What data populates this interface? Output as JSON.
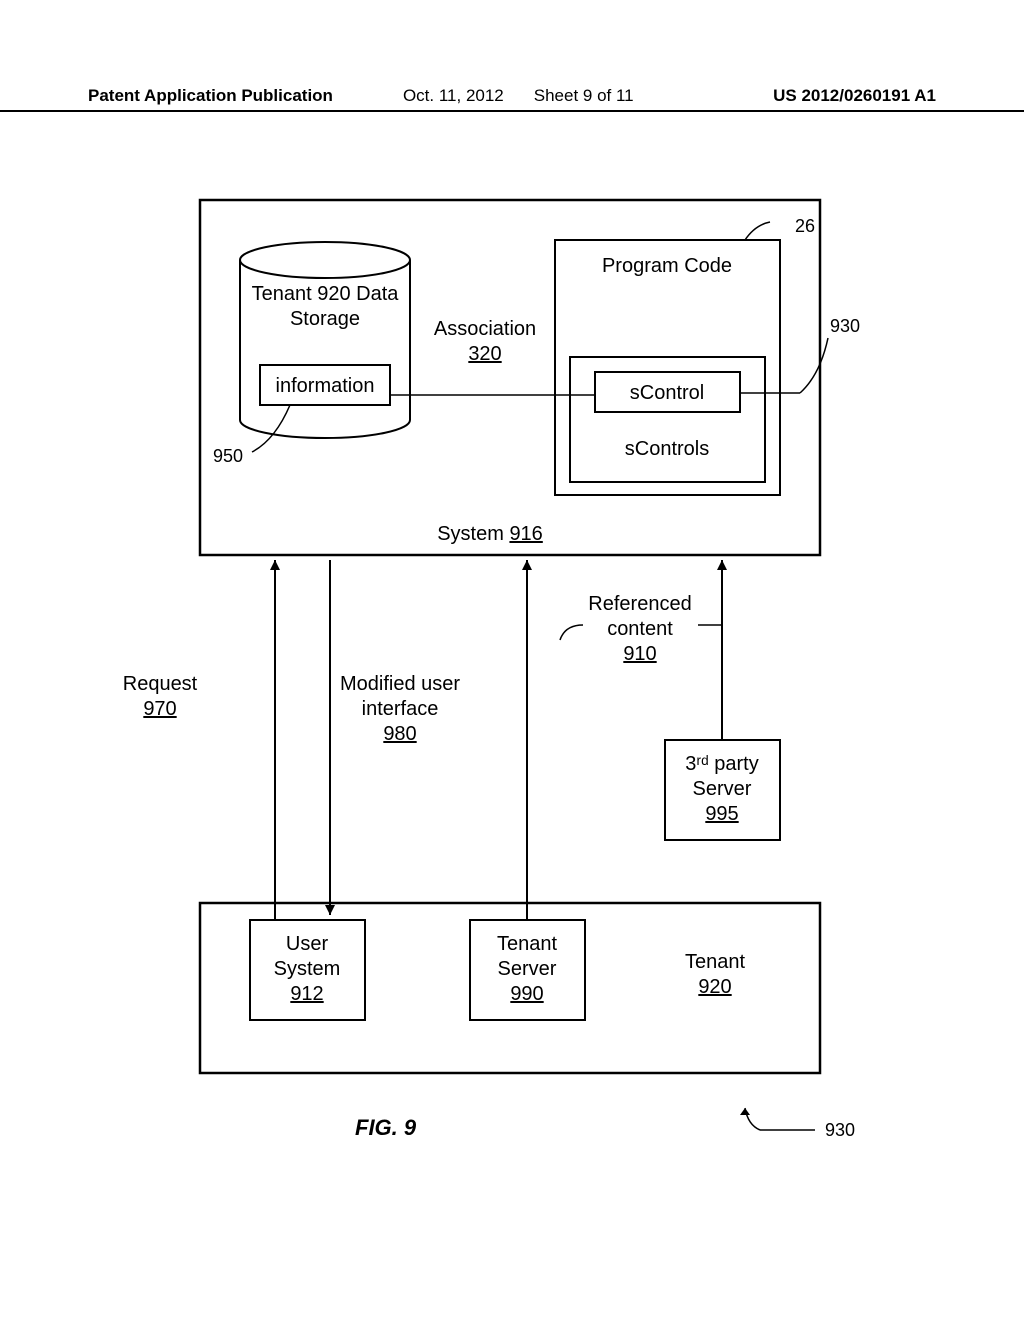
{
  "header": {
    "left": "Patent Application Publication",
    "date": "Oct. 11, 2012",
    "sheet": "Sheet 9 of 11",
    "pubno": "US 2012/0260191 A1"
  },
  "boxes": {
    "storage_line1": "Tenant 920 Data",
    "storage_line2": "Storage",
    "information": "information",
    "association_label": "Association",
    "association_num": "320",
    "program_code": "Program Code",
    "scontrol": "sControl",
    "scontrols": "sControls",
    "system_label": "System",
    "system_num": "916",
    "request_label": "Request",
    "request_num": "970",
    "modified_l1": "Modified user",
    "modified_l2": "interface",
    "modified_num": "980",
    "referenced_l1": "Referenced",
    "referenced_l2": "content",
    "referenced_num": "910",
    "third_party_l1": "3ʳᵈ party",
    "third_party_l2": "Server",
    "third_party_num": "995",
    "user_system_l1": "User",
    "user_system_l2": "System",
    "user_system_num": "912",
    "tenant_server_l1": "Tenant",
    "tenant_server_l2": "Server",
    "tenant_server_num": "990",
    "tenant_l1": "Tenant",
    "tenant_num": "920"
  },
  "callouts": {
    "c26": "26",
    "c930a": "930",
    "c950": "950",
    "c930b": "930"
  },
  "figure": "FIG. 9"
}
